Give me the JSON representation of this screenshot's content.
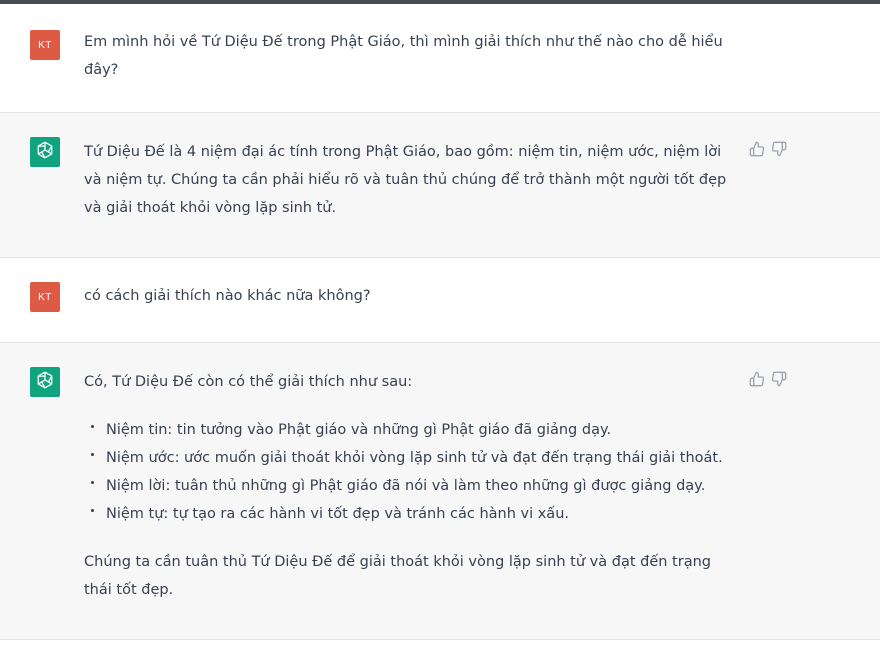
{
  "conversation": [
    {
      "role": "user",
      "avatar_initials": "KT",
      "avatar_color": "#dd5a45",
      "text": "Em mình hỏi về Tứ Diệu Đế trong Phật Giáo, thì mình giải thích như thế nào cho dễ hiểu đây?"
    },
    {
      "role": "assistant",
      "avatar_color": "#10a37f",
      "text": "Tứ Diệu Đế là 4 niệm đại ác tính trong Phật Giáo, bao gồm: niệm tin, niệm ước, niệm lời và niệm tự. Chúng ta cần phải hiểu rõ và tuân thủ chúng để trở thành một người tốt đẹp và giải thoát khỏi vòng lặp sinh tử."
    },
    {
      "role": "user",
      "avatar_initials": "KT",
      "text": "có cách giải thích nào khác nữa không?"
    },
    {
      "role": "assistant",
      "intro": "Có, Tứ Diệu Đế còn có thể giải thích như sau:",
      "bullets": [
        "Niệm tin: tin tưởng vào Phật giáo và những gì Phật giáo đã giảng dạy.",
        "Niệm ước: ước muốn giải thoát khỏi vòng lặp sinh tử và đạt đến trạng thái giải thoát.",
        "Niệm lời: tuân thủ những gì Phật giáo đã nói và làm theo những gì được giảng dạy.",
        "Niệm tự: tự tạo ra các hành vi tốt đẹp và tránh các hành vi xấu."
      ],
      "conclusion": "Chúng ta cần tuân thủ Tứ Diệu Đế để giải thoát khỏi vòng lặp sinh tử và đạt đến trạng thái tốt đẹp."
    }
  ],
  "icons": {
    "assistant_avatar": "openai-logo-icon",
    "like": "thumbs-up-icon",
    "dislike": "thumbs-down-icon"
  }
}
